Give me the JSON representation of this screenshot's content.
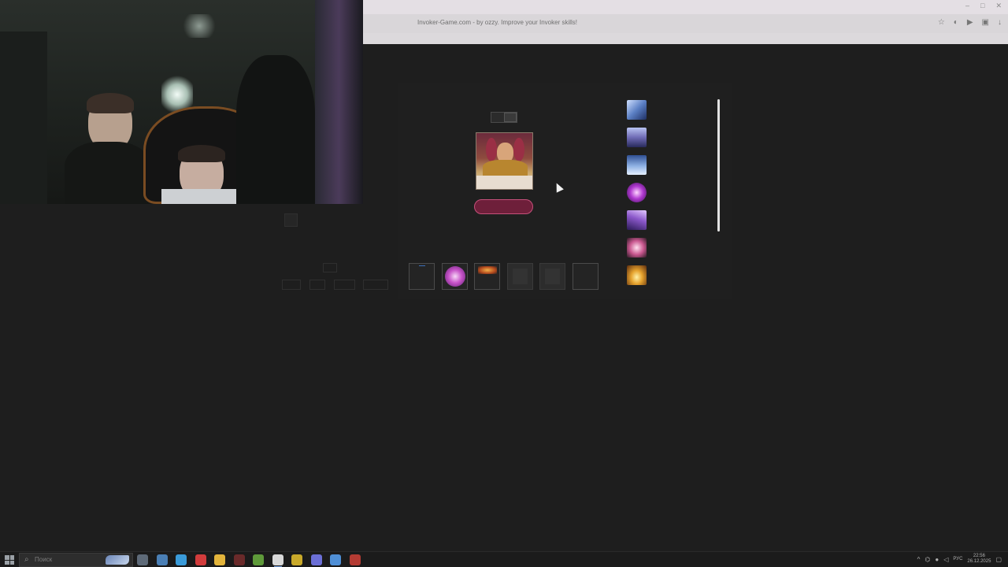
{
  "browser": {
    "title": "Invoker-Game.com - by ozzy. Improve your Invoker skills!"
  },
  "window_controls": {
    "minimize": "–",
    "maximize": "□",
    "close": "✕"
  },
  "game": {
    "hero": "Invoker",
    "invoked_slots": [
      {
        "filled": false
      },
      {
        "filled": true,
        "spell": "Alacrity"
      },
      {
        "filled": true,
        "spell": "Chaos Meteor"
      },
      {
        "filled": false
      },
      {
        "filled": false
      },
      {
        "filled": false
      }
    ],
    "spell_list": [
      {
        "icon": "cold-snap-icon",
        "color": "#5b7fc4"
      },
      {
        "icon": "ghost-walk-icon",
        "color": "#6f6bb5"
      },
      {
        "icon": "ice-wall-icon",
        "color": "#8fb1e4"
      },
      {
        "icon": "emp-icon",
        "color": "#b13ad1"
      },
      {
        "icon": "tornado-icon",
        "color": "#8a57c9"
      },
      {
        "icon": "alacrity-icon",
        "color": "#c9578f"
      },
      {
        "icon": "forge-spirit-icon",
        "color": "#e6a32e"
      }
    ]
  },
  "taskbar": {
    "search_placeholder": "Поиск",
    "language": "РУС",
    "time": "22:56",
    "date": "26.12.2025",
    "apps": [
      {
        "name": "task-view",
        "color": "#5e6a78"
      },
      {
        "name": "steam",
        "color": "#4a7fb5"
      },
      {
        "name": "telegram",
        "color": "#3a9bd9"
      },
      {
        "name": "opera-gx",
        "color": "#d23c3c"
      },
      {
        "name": "file-explorer",
        "color": "#e3b43b"
      },
      {
        "name": "obs",
        "color": "#6a2a2a"
      },
      {
        "name": "minecraft",
        "color": "#5f9a3a"
      },
      {
        "name": "yandex-browser",
        "color": "#d8d8d8"
      },
      {
        "name": "twitch-overlay",
        "color": "#c9a92a"
      },
      {
        "name": "discord-app",
        "color": "#6b6fd6"
      },
      {
        "name": "chrome",
        "color": "#4f8fd6"
      },
      {
        "name": "dota-2",
        "color": "#b43b33"
      }
    ]
  }
}
